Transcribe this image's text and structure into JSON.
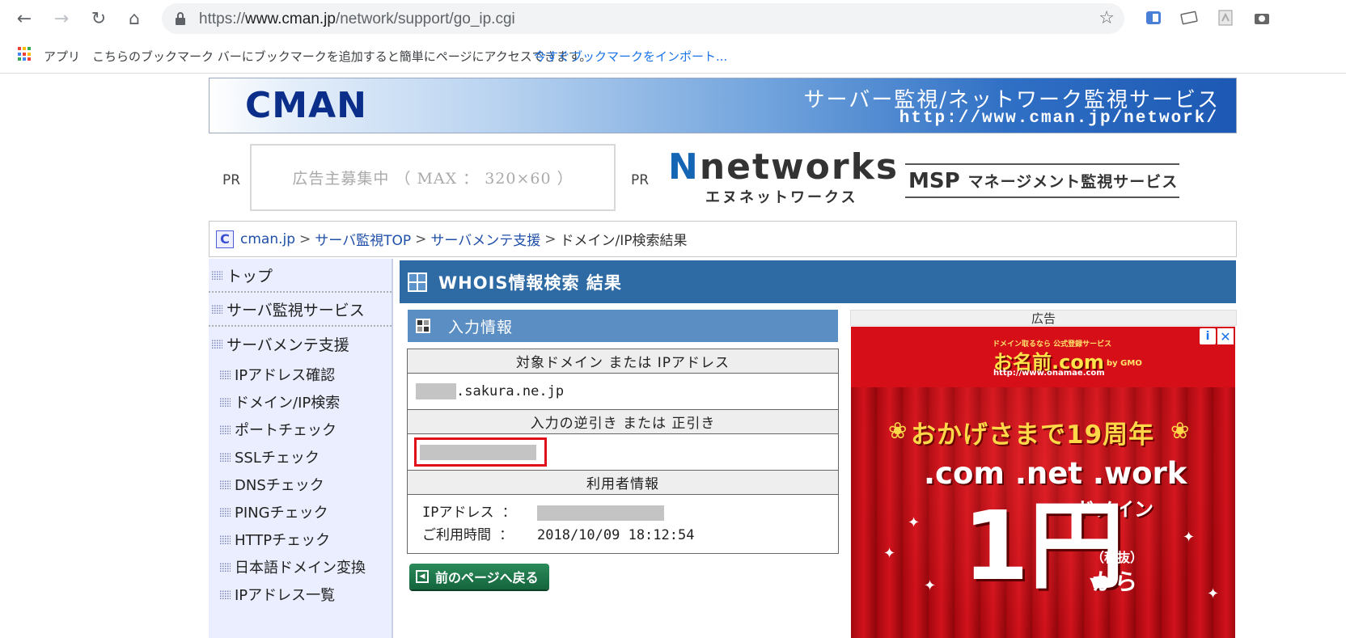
{
  "browser": {
    "url_scheme": "https://",
    "url_host": "www.cman.jp",
    "url_path": "/network/support/go_ip.cgi",
    "bookmarks": {
      "apps_label": "アプリ",
      "message": "こちらのブックマーク バーにブックマークを追加すると簡単にページにアクセスできます。",
      "import_link": "今すぐブックマークをインポート..."
    }
  },
  "banner": {
    "logo": "CMAN",
    "headline": "サーバー監視/ネットワーク監視サービス",
    "url": "http://www.cman.jp/network/"
  },
  "pr": {
    "label_left": "PR",
    "placeholder": "広告主募集中 （ MAX ： 320×60 ）",
    "label_right": "PR",
    "nnet_prefix": "N",
    "nnet_word": "networks",
    "nnet_sub": "エヌネットワークス",
    "msp_big": "MSP",
    "msp_small": "マネージメント監視サービス"
  },
  "breadcrumb": {
    "items": [
      "cman.jp",
      "サーバ監視TOP",
      "サーバメンテ支援"
    ],
    "current": "ドメイン/IP検索結果",
    "separator": ">"
  },
  "sidenav": {
    "top_items": [
      "トップ",
      "サーバ監視サービス",
      "サーバメンテ支援"
    ],
    "sub_items": [
      "IPアドレス確認",
      "ドメイン/IP検索",
      "ポートチェック",
      "SSLチェック",
      "DNSチェック",
      "PINGチェック",
      "HTTPチェック",
      "日本語ドメイン変換",
      "IPアドレス一覧"
    ]
  },
  "main": {
    "title": "WHOIS情報検索 結果",
    "section_title": "入力情報",
    "table": {
      "domain_header": "対象ドメイン または IPアドレス",
      "domain_value": ".sakura.ne.jp",
      "reverse_header": "入力の逆引き または 正引き",
      "user_header": "利用者情報",
      "ip_label": "IPアドレス ：",
      "time_label": "ご利用時間 ：",
      "time_value": "2018/10/09 18:12:54"
    },
    "back_button": "前のページへ戻る"
  },
  "ad": {
    "label": "広告",
    "top_small": "ドメイン取るなら 公式登録サービス",
    "brand": "お名前.com",
    "brand_url": "http://www.onamae.com",
    "brand_suffix": "by GMO",
    "anniversary": "おかげさまで19周年",
    "tlds": ".com .net .work",
    "domain_word": "ドメイン",
    "price": "1円",
    "tax": "（税抜）",
    "from": "から"
  },
  "colors": {
    "header_blue": "#2e6aa3",
    "section_blue": "#5b8fc4",
    "nav_bg": "#eaeeff",
    "highlight_red": "#e0101a",
    "link_blue": "#1f4fa8"
  }
}
